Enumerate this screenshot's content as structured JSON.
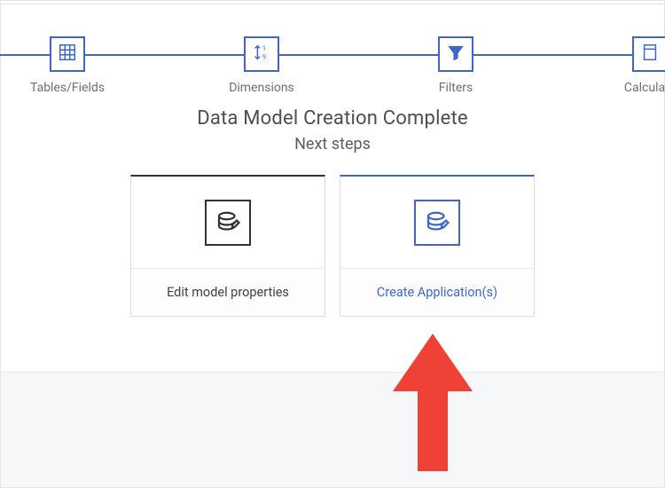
{
  "stepper": {
    "steps": [
      {
        "label": "Tables/Fields",
        "icon": "grid-icon"
      },
      {
        "label": "Dimensions",
        "icon": "dimensions-icon"
      },
      {
        "label": "Filters",
        "icon": "funnel-icon"
      },
      {
        "label": "Calculate",
        "icon": "calc-icon"
      }
    ],
    "color": "#3f66c7"
  },
  "headline": {
    "title": "Data Model Creation Complete",
    "subtitle": "Next steps"
  },
  "cards": {
    "edit": {
      "label": "Edit model properties"
    },
    "create": {
      "label": "Create Application(s)"
    }
  },
  "annotation": {
    "kind": "up-arrow",
    "color": "#ef4136"
  }
}
